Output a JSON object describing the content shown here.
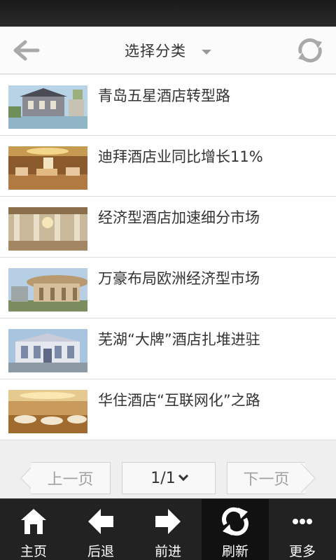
{
  "header": {
    "title": "选择分类"
  },
  "articles": [
    {
      "title": "青岛五星酒店转型路"
    },
    {
      "title": "迪拜酒店业同比增长11%"
    },
    {
      "title": "经济型酒店加速细分市场"
    },
    {
      "title": "万豪布局欧洲经济型市场"
    },
    {
      "title": "芜湖“大牌”酒店扎堆进驻"
    },
    {
      "title": "华住酒店“互联网化”之路"
    }
  ],
  "pager": {
    "prev_label": "上一页",
    "page_label": "1/1",
    "next_label": "下一页"
  },
  "bottom_nav": {
    "home": "主页",
    "back": "后退",
    "forward": "前进",
    "refresh": "刷新",
    "more": "更多"
  },
  "colors": {
    "nav_bg": "#222222",
    "header_bg": "#fbfbfb",
    "text": "#333333"
  }
}
